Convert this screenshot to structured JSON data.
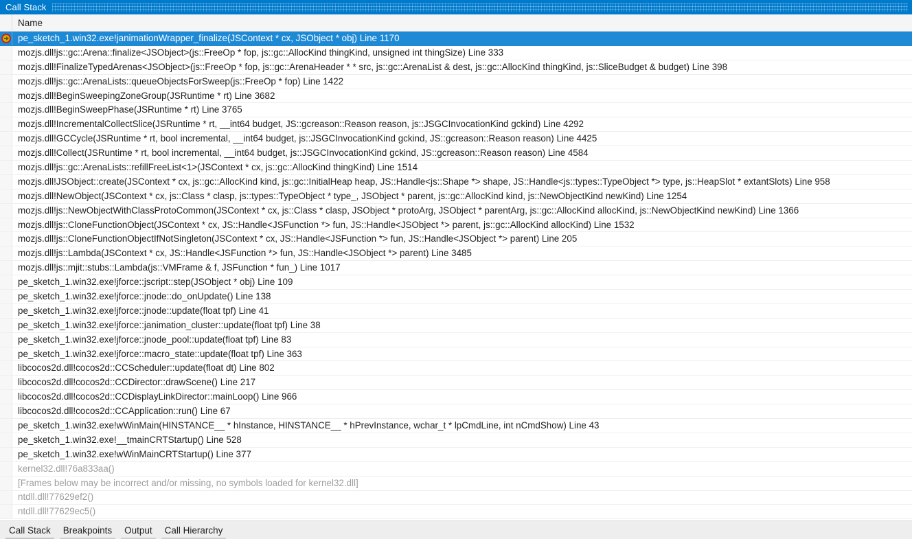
{
  "window": {
    "title": "Call Stack",
    "title_bar_color": "#007acc",
    "selection_color": "#1e8ad6"
  },
  "columns": [
    {
      "key": "icon",
      "label": ""
    },
    {
      "key": "name",
      "label": "Name"
    }
  ],
  "call_stack": {
    "selected_index": 0,
    "current_statement_icon": "current-statement-arrow-icon",
    "frames": [
      {
        "name": "pe_sketch_1.win32.exe!janimationWrapper_finalize(JSContext * cx, JSObject * obj) Line 1170",
        "selected": true,
        "dim": false,
        "icon": "current-statement-arrow-icon"
      },
      {
        "name": "mozjs.dll!js::gc::Arena::finalize<JSObject>(js::FreeOp * fop, js::gc::AllocKind thingKind, unsigned int thingSize) Line 333",
        "selected": false,
        "dim": false,
        "icon": ""
      },
      {
        "name": "mozjs.dll!FinalizeTypedArenas<JSObject>(js::FreeOp * fop, js::gc::ArenaHeader * * src, js::gc::ArenaList & dest, js::gc::AllocKind thingKind, js::SliceBudget & budget) Line 398",
        "selected": false,
        "dim": false,
        "icon": ""
      },
      {
        "name": "mozjs.dll!js::gc::ArenaLists::queueObjectsForSweep(js::FreeOp * fop) Line 1422",
        "selected": false,
        "dim": false,
        "icon": ""
      },
      {
        "name": "mozjs.dll!BeginSweepingZoneGroup(JSRuntime * rt) Line 3682",
        "selected": false,
        "dim": false,
        "icon": ""
      },
      {
        "name": "mozjs.dll!BeginSweepPhase(JSRuntime * rt) Line 3765",
        "selected": false,
        "dim": false,
        "icon": ""
      },
      {
        "name": "mozjs.dll!IncrementalCollectSlice(JSRuntime * rt, __int64 budget, JS::gcreason::Reason reason, js::JSGCInvocationKind gckind) Line 4292",
        "selected": false,
        "dim": false,
        "icon": ""
      },
      {
        "name": "mozjs.dll!GCCycle(JSRuntime * rt, bool incremental, __int64 budget, js::JSGCInvocationKind gckind, JS::gcreason::Reason reason) Line 4425",
        "selected": false,
        "dim": false,
        "icon": ""
      },
      {
        "name": "mozjs.dll!Collect(JSRuntime * rt, bool incremental, __int64 budget, js::JSGCInvocationKind gckind, JS::gcreason::Reason reason) Line 4584",
        "selected": false,
        "dim": false,
        "icon": ""
      },
      {
        "name": "mozjs.dll!js::gc::ArenaLists::refillFreeList<1>(JSContext * cx, js::gc::AllocKind thingKind) Line 1514",
        "selected": false,
        "dim": false,
        "icon": ""
      },
      {
        "name": "mozjs.dll!JSObject::create(JSContext * cx, js::gc::AllocKind kind, js::gc::InitialHeap heap, JS::Handle<js::Shape *> shape, JS::Handle<js::types::TypeObject *> type, js::HeapSlot * extantSlots) Line 958",
        "selected": false,
        "dim": false,
        "icon": ""
      },
      {
        "name": "mozjs.dll!NewObject(JSContext * cx, js::Class * clasp, js::types::TypeObject * type_, JSObject * parent, js::gc::AllocKind kind, js::NewObjectKind newKind) Line 1254",
        "selected": false,
        "dim": false,
        "icon": ""
      },
      {
        "name": "mozjs.dll!js::NewObjectWithClassProtoCommon(JSContext * cx, js::Class * clasp, JSObject * protoArg, JSObject * parentArg, js::gc::AllocKind allocKind, js::NewObjectKind newKind) Line 1366",
        "selected": false,
        "dim": false,
        "icon": ""
      },
      {
        "name": "mozjs.dll!js::CloneFunctionObject(JSContext * cx, JS::Handle<JSFunction *> fun, JS::Handle<JSObject *> parent, js::gc::AllocKind allocKind) Line 1532",
        "selected": false,
        "dim": false,
        "icon": ""
      },
      {
        "name": "mozjs.dll!js::CloneFunctionObjectIfNotSingleton(JSContext * cx, JS::Handle<JSFunction *> fun, JS::Handle<JSObject *> parent) Line 205",
        "selected": false,
        "dim": false,
        "icon": ""
      },
      {
        "name": "mozjs.dll!js::Lambda(JSContext * cx, JS::Handle<JSFunction *> fun, JS::Handle<JSObject *> parent) Line 3485",
        "selected": false,
        "dim": false,
        "icon": ""
      },
      {
        "name": "mozjs.dll!js::mjit::stubs::Lambda(js::VMFrame & f, JSFunction * fun_) Line 1017",
        "selected": false,
        "dim": false,
        "icon": ""
      },
      {
        "name": "pe_sketch_1.win32.exe!jforce::jscript::step(JSObject * obj) Line 109",
        "selected": false,
        "dim": false,
        "icon": ""
      },
      {
        "name": "pe_sketch_1.win32.exe!jforce::jnode::do_onUpdate() Line 138",
        "selected": false,
        "dim": false,
        "icon": ""
      },
      {
        "name": "pe_sketch_1.win32.exe!jforce::jnode::update(float tpf) Line 41",
        "selected": false,
        "dim": false,
        "icon": ""
      },
      {
        "name": "pe_sketch_1.win32.exe!jforce::janimation_cluster::update(float tpf) Line 38",
        "selected": false,
        "dim": false,
        "icon": ""
      },
      {
        "name": "pe_sketch_1.win32.exe!jforce::jnode_pool::update(float tpf) Line 83",
        "selected": false,
        "dim": false,
        "icon": ""
      },
      {
        "name": "pe_sketch_1.win32.exe!jforce::macro_state::update(float tpf) Line 363",
        "selected": false,
        "dim": false,
        "icon": ""
      },
      {
        "name": "libcocos2d.dll!cocos2d::CCScheduler::update(float dt) Line 802",
        "selected": false,
        "dim": false,
        "icon": ""
      },
      {
        "name": "libcocos2d.dll!cocos2d::CCDirector::drawScene() Line 217",
        "selected": false,
        "dim": false,
        "icon": ""
      },
      {
        "name": "libcocos2d.dll!cocos2d::CCDisplayLinkDirector::mainLoop() Line 966",
        "selected": false,
        "dim": false,
        "icon": ""
      },
      {
        "name": "libcocos2d.dll!cocos2d::CCApplication::run() Line 67",
        "selected": false,
        "dim": false,
        "icon": ""
      },
      {
        "name": "pe_sketch_1.win32.exe!wWinMain(HINSTANCE__ * hInstance, HINSTANCE__ * hPrevInstance, wchar_t * lpCmdLine, int nCmdShow) Line 43",
        "selected": false,
        "dim": false,
        "icon": ""
      },
      {
        "name": "pe_sketch_1.win32.exe!__tmainCRTStartup() Line 528",
        "selected": false,
        "dim": false,
        "icon": ""
      },
      {
        "name": "pe_sketch_1.win32.exe!wWinMainCRTStartup() Line 377",
        "selected": false,
        "dim": false,
        "icon": ""
      },
      {
        "name": "kernel32.dll!76a833aa()",
        "selected": false,
        "dim": true,
        "icon": ""
      },
      {
        "name": "[Frames below may be incorrect and/or missing, no symbols loaded for kernel32.dll]",
        "selected": false,
        "dim": true,
        "icon": ""
      },
      {
        "name": "ntdll.dll!77629ef2()",
        "selected": false,
        "dim": true,
        "icon": ""
      },
      {
        "name": "ntdll.dll!77629ec5()",
        "selected": false,
        "dim": true,
        "icon": ""
      }
    ]
  },
  "tabs": [
    {
      "label": "Call Stack",
      "active": true
    },
    {
      "label": "Breakpoints",
      "active": false
    },
    {
      "label": "Output",
      "active": false
    },
    {
      "label": "Call Hierarchy",
      "active": false
    }
  ]
}
